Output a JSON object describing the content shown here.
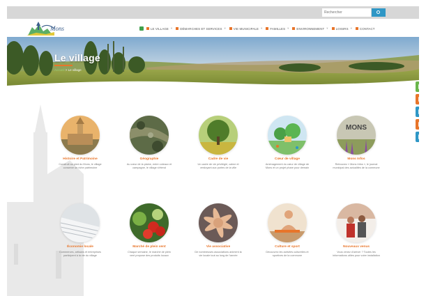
{
  "search": {
    "placeholder": "Rechercher"
  },
  "nav": [
    {
      "label": "Le village"
    },
    {
      "label": "Démarches et services"
    },
    {
      "label": "Vie municipale"
    },
    {
      "label": "Familles"
    },
    {
      "label": "Environnement"
    },
    {
      "label": "Loisirs"
    },
    {
      "label": "Contact"
    }
  ],
  "hero": {
    "title": "Le village",
    "breadcrumb_home": "Accueil",
    "breadcrumb_sep": " > ",
    "breadcrumb_current": "Le village"
  },
  "cards": [
    {
      "title": "Histoire et Patrimoine",
      "desc": "Construit au pied du Mons, le village conserve un riche patrimoine",
      "icon": "church-photo"
    },
    {
      "title": "Géographie",
      "desc": "Au cœur de la plaine, entre coteaux et campagne, le village s'étend",
      "icon": "aerial-photo"
    },
    {
      "title": "Cadre de vie",
      "desc": "Un cadre de vie privilégié, calme et verdoyant aux portes de la ville",
      "icon": "tree-photo"
    },
    {
      "title": "Cœur de village",
      "desc": "Aménagement du cœur de village de Mons et un projet phare pour demain",
      "icon": "village-illustration"
    },
    {
      "title": "Mons Infos",
      "desc": "Retrouvez « Mons Infos », le journal municipal des actualités de la commune",
      "icon": "magazine-cover"
    },
    {
      "title": "Économie locale",
      "desc": "Commerces, artisans et entreprises participent à la vie du village",
      "icon": "ledger-photo"
    },
    {
      "title": "Marché de plein vent",
      "desc": "Chaque semaine, le marché de plein vent propose des produits locaux",
      "icon": "vegetables-photo"
    },
    {
      "title": "Vie associative",
      "desc": "De nombreuses associations animent la vie locale tout au long de l'année",
      "icon": "hands-photo"
    },
    {
      "title": "Culture et sport",
      "desc": "Découvrez les activités culturelles et sportives de la commune",
      "icon": "yoga-photo"
    },
    {
      "title": "Nouveaux venus",
      "desc": "Vous venez d'arriver ? Toutes les informations utiles pour votre installation",
      "icon": "family-photo"
    }
  ],
  "colors": {
    "accent": "#e8752a",
    "nav_green": "#3fa04b",
    "search_btn": "#2f97c6",
    "side_buttons": [
      "#6ab64b",
      "#e8752a",
      "#2f97c6",
      "#e8752a",
      "#2f97c6"
    ]
  }
}
